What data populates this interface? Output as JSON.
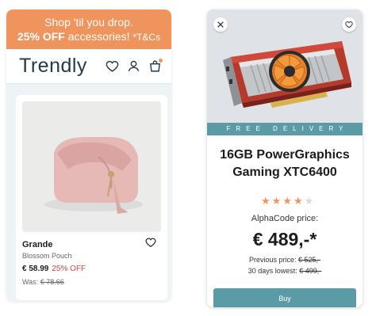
{
  "promo": {
    "line1": "Shop 'til you drop.",
    "highlight": "25% OFF",
    "rest": " accessories!",
    "terms": "*T&Cs apply"
  },
  "header": {
    "logo": "Trendly",
    "icons": [
      "heart-icon",
      "user-icon",
      "cart-icon"
    ]
  },
  "left_product": {
    "name": "Grande",
    "subtitle": "Blossom Pouch",
    "price": "€ 58.99",
    "discount": "25% OFF",
    "was_label": "Was:",
    "was_price": "€ 78.66"
  },
  "right_product": {
    "delivery": "FREE DELIVERY",
    "title": "16GB PowerGraphics Gaming XTC6400",
    "rating": 4,
    "rating_max": 5,
    "vendor_label": "AlphaCode price:",
    "price": "€ 489,-*",
    "previous_label": "Previous price:",
    "previous_value": "€ 525,-",
    "lowest_label": "30 days lowest:",
    "lowest_value": "€ 499,-",
    "buy_label": "Buy"
  },
  "colors": {
    "accent_orange": "#f0945d",
    "accent_teal": "#5b9ba5",
    "discount_red": "#d24848",
    "logo_navy": "#233a4a"
  }
}
